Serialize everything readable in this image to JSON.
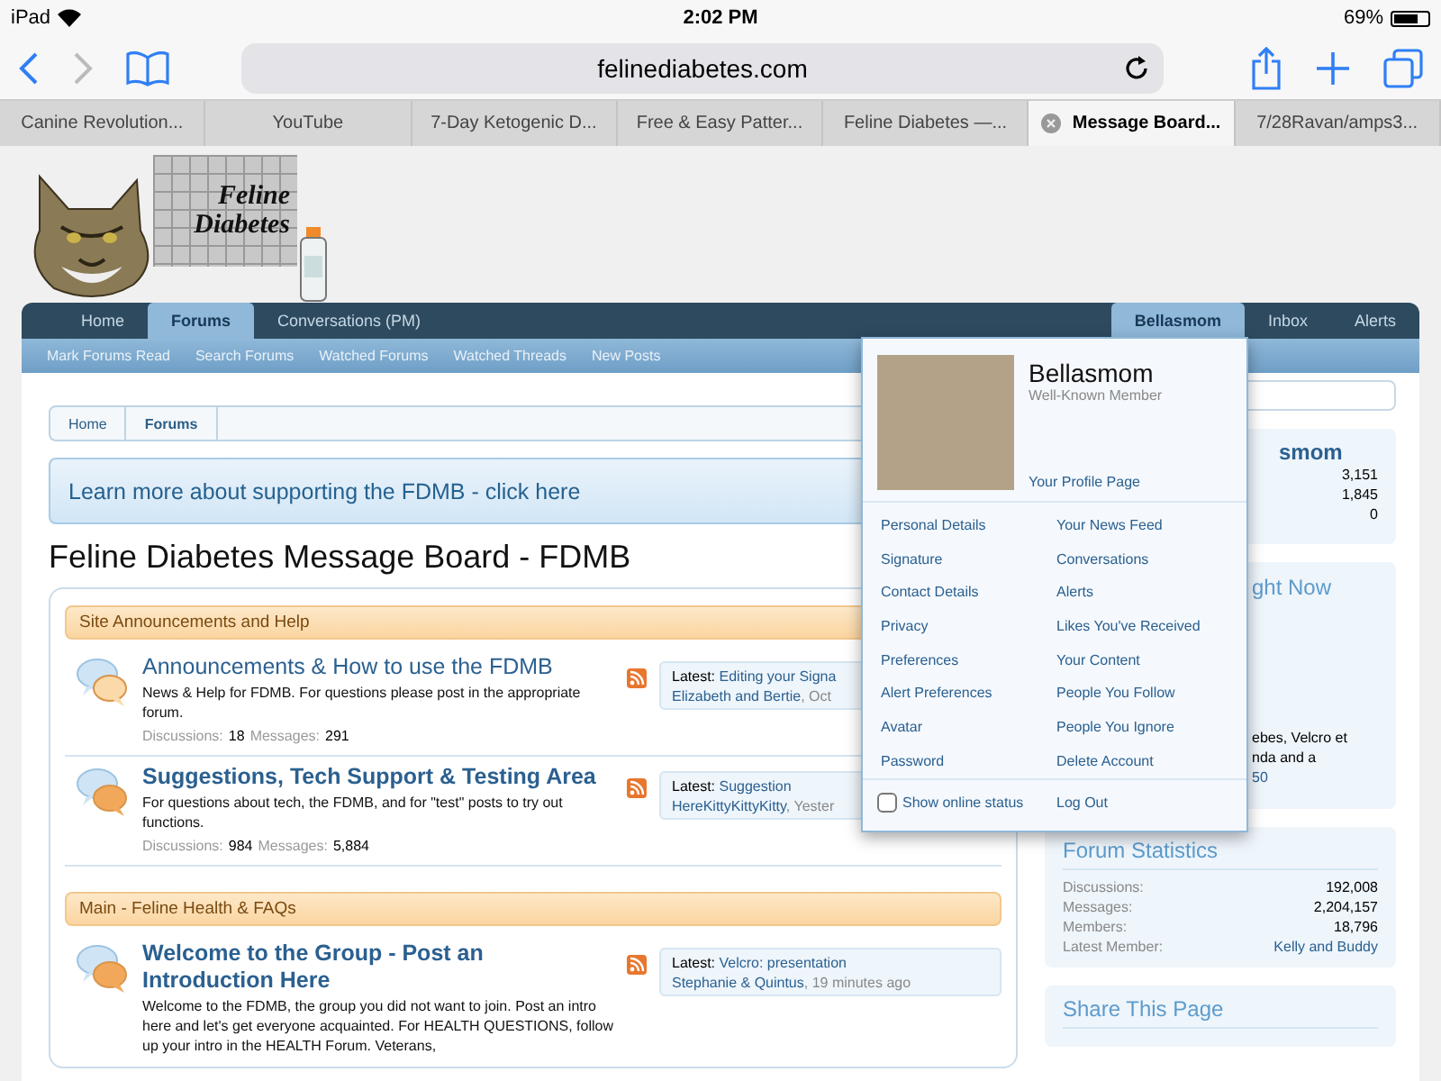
{
  "status_bar": {
    "device": "iPad",
    "time": "2:02 PM",
    "battery": "69%"
  },
  "browser": {
    "url": "felinediabetes.com",
    "tabs": [
      {
        "label": "Canine Revolution...",
        "selected": false
      },
      {
        "label": "YouTube",
        "selected": false
      },
      {
        "label": "7-Day Ketogenic D...",
        "selected": false
      },
      {
        "label": "Free & Easy Patter...",
        "selected": false
      },
      {
        "label": "Feline Diabetes —...",
        "selected": false
      },
      {
        "label": "Message Board...",
        "selected": true
      },
      {
        "label": "7/28Ravan/amps3...",
        "selected": false
      }
    ]
  },
  "logo": {
    "lines": [
      "Feline",
      "Diabetes"
    ]
  },
  "nav": {
    "left": [
      {
        "label": "Home",
        "selected": false
      },
      {
        "label": "Forums",
        "selected": true
      },
      {
        "label": "Conversations (PM)",
        "selected": false
      }
    ],
    "right": [
      {
        "label": "Bellasmom",
        "selected": true
      },
      {
        "label": "Inbox",
        "selected": false
      },
      {
        "label": "Alerts",
        "selected": false
      }
    ],
    "sub": [
      "Mark Forums Read",
      "Search Forums",
      "Watched Forums",
      "Watched Threads",
      "New Posts"
    ]
  },
  "breadcrumb": [
    {
      "label": "Home",
      "current": false
    },
    {
      "label": "Forums",
      "current": true
    }
  ],
  "banner": "Learn more about supporting the FDMB - click here",
  "page_title": "Feline Diabetes Message Board - FDMB",
  "categories": [
    {
      "title": "Site Announcements and Help",
      "forums": [
        {
          "title": "Announcements & How to use the FDMB",
          "unread": false,
          "description": "News & Help for FDMB. For questions please post in the appropriate forum.",
          "stats": [
            {
              "label": "Discussions:",
              "value": "18"
            },
            {
              "label": "Messages:",
              "value": "291"
            }
          ],
          "latest": {
            "label": "Latest:",
            "thread": "Editing your Signa",
            "user": "Elizabeth and Bertie",
            "time": ", Oct"
          }
        },
        {
          "title": "Suggestions, Tech Support & Testing Area",
          "unread": true,
          "description": "For questions about tech, the FDMB, and for \"test\" posts to try out functions.",
          "stats": [
            {
              "label": "Discussions:",
              "value": "984"
            },
            {
              "label": "Messages:",
              "value": "5,884"
            }
          ],
          "latest": {
            "label": "Latest:",
            "thread": "Suggestion",
            "user": "HereKittyKittyKitty",
            "time": ", Yester"
          }
        }
      ]
    },
    {
      "title": "Main - Feline Health & FAQs",
      "forums": [
        {
          "title": "Welcome to the Group - Post an Introduction Here",
          "unread": true,
          "description": "Welcome to the FDMB, the group you did not want to join. Post an intro here and let's get everyone acquainted. For HEALTH QUESTIONS, follow up your intro in the HEALTH Forum. Veterans,",
          "latest": {
            "label": "Latest:",
            "thread": "Velcro: presentation",
            "user": "Stephanie & Quintus",
            "time": ", 19 minutes ago"
          }
        }
      ]
    }
  ],
  "sidebar": {
    "profile": {
      "name": "smom",
      "stats": [
        "3,151",
        "1,845",
        "0"
      ]
    },
    "members": {
      "heading": "ght Now",
      "lines": [
        "ebes, Velcro et",
        "nda and a"
      ],
      "count": "50"
    },
    "statistics": {
      "title": "Forum Statistics",
      "rows": [
        {
          "label": "Discussions:",
          "value": "192,008",
          "link": false
        },
        {
          "label": "Messages:",
          "value": "2,204,157",
          "link": false
        },
        {
          "label": "Members:",
          "value": "18,796",
          "link": false
        },
        {
          "label": "Latest Member:",
          "value": "Kelly and Buddy",
          "link": true
        }
      ]
    },
    "share": {
      "title": "Share This Page"
    }
  },
  "user_menu": {
    "name": "Bellasmom",
    "title": "Well-Known Member",
    "profile_link": "Your Profile Page",
    "left": [
      "Personal Details",
      "Signature",
      "Contact Details",
      "Privacy",
      "Preferences",
      "Alert Preferences",
      "Avatar",
      "Password"
    ],
    "right": [
      "Your News Feed",
      "Conversations",
      "Alerts",
      "Likes You've Received",
      "Your Content",
      "People You Follow",
      "People You Ignore",
      "Delete Account"
    ],
    "online_status": {
      "label": "Show online status",
      "checked": false
    },
    "logout": "Log Out"
  }
}
